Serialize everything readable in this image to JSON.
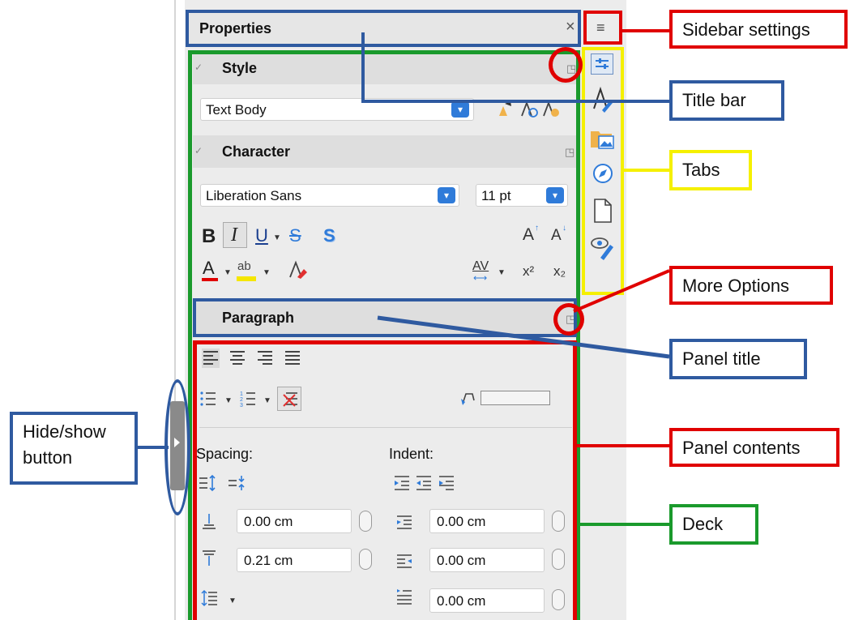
{
  "sidebar": {
    "title": "Properties",
    "close_glyph": "×",
    "settings_glyph": "≡",
    "tabs": [
      {
        "icon": "properties-tab-icon"
      },
      {
        "icon": "styles-tab-icon"
      },
      {
        "icon": "gallery-tab-icon"
      },
      {
        "icon": "navigator-tab-icon"
      },
      {
        "icon": "page-tab-icon"
      },
      {
        "icon": "style-inspector-tab-icon"
      }
    ]
  },
  "style_panel": {
    "title": "Style",
    "paragraph_style": "Text Body"
  },
  "character_panel": {
    "title": "Character",
    "font_name": "Liberation Sans",
    "font_size": "11 pt",
    "bold": "B",
    "italic": "I",
    "underline": "U",
    "strikethrough": "S",
    "shadow": "S",
    "grow_font": "A",
    "shrink_font": "A",
    "font_color": "A",
    "highlight": "ab",
    "spacing": "AV",
    "superscript": "x²",
    "subscript": "x₂"
  },
  "paragraph_panel": {
    "title": "Paragraph",
    "spacing_label": "Spacing:",
    "indent_label": "Indent:",
    "above_spacing": "0.00 cm",
    "below_spacing": "0.21 cm",
    "before_indent": "0.00 cm",
    "after_indent": "0.00 cm",
    "first_line_indent": "0.00 cm"
  },
  "annotations": {
    "sidebar_settings": "Sidebar settings",
    "title_bar": "Title bar",
    "tabs": "Tabs",
    "more_options": "More Options",
    "panel_title": "Panel title",
    "hide_show_line1": "Hide/show",
    "hide_show_line2": "button",
    "panel_contents": "Panel contents",
    "deck": "Deck"
  },
  "colors": {
    "annotation_red": "#e00000",
    "annotation_blue": "#2f5aa0",
    "annotation_green": "#1a9a2c",
    "annotation_yellow": "#f5f000",
    "combo_button_blue": "#2f7bd9"
  }
}
